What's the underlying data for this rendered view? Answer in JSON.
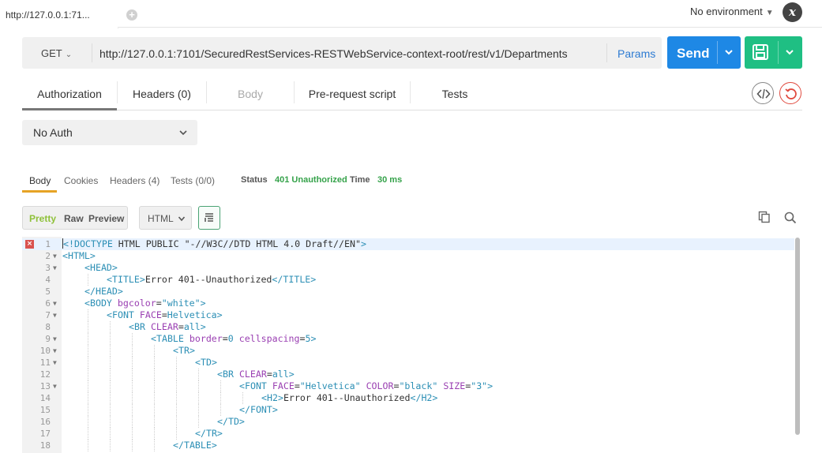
{
  "tab": {
    "label": "http://127.0.0.1:71...",
    "add_label": "+"
  },
  "environment": {
    "label": "No environment",
    "clear_label": "x"
  },
  "request": {
    "method": "GET",
    "url": "http://127.0.0.1:7101/SecuredRestServices-RESTWebService-context-root/rest/v1/Departments",
    "params_label": "Params",
    "send_label": "Send"
  },
  "request_tabs": [
    {
      "label": "Authorization",
      "active": true
    },
    {
      "label": "Headers (0)"
    },
    {
      "label": "Body",
      "disabled": true
    },
    {
      "label": "Pre-request script"
    },
    {
      "label": "Tests"
    }
  ],
  "auth": {
    "selected": "No Auth"
  },
  "response_tabs": [
    {
      "label": "Body",
      "active": true
    },
    {
      "label": "Cookies"
    },
    {
      "label": "Headers (4)"
    },
    {
      "label": "Tests (0/0)"
    }
  ],
  "status": {
    "status_label": "Status",
    "status_value": "401 Unauthorized",
    "time_label": "Time",
    "time_value": "30 ms"
  },
  "view": {
    "modes": [
      "Pretty",
      "Raw",
      "Preview"
    ],
    "active_mode": "Pretty",
    "language": "HTML"
  },
  "colors": {
    "send": "#1e88e5",
    "save": "#1fbf83",
    "status_ok": "#35a24a",
    "accent": "#e6a325"
  },
  "icons": [
    "chevron-down-icon",
    "save-icon",
    "code-icon",
    "reset-icon",
    "wrap-icon",
    "copy-icon",
    "search-icon",
    "error-icon"
  ],
  "code_lines": [
    {
      "n": "1",
      "text": "<!DOCTYPE HTML PUBLIC \"-//W3C//DTD HTML 4.0 Draft//EN\">"
    },
    {
      "n": "2",
      "text": "<HTML>"
    },
    {
      "n": "3",
      "text": "<HEAD>"
    },
    {
      "n": "4",
      "text": "<TITLE>Error 401--Unauthorized</TITLE>"
    },
    {
      "n": "5",
      "text": "</HEAD>"
    },
    {
      "n": "6",
      "text": "<BODY bgcolor=\"white\">"
    },
    {
      "n": "7",
      "text": "<FONT FACE=Helvetica>"
    },
    {
      "n": "8",
      "text": "<BR CLEAR=all>"
    },
    {
      "n": "9",
      "text": "<TABLE border=0 cellspacing=5>"
    },
    {
      "n": "10",
      "text": "<TR>"
    },
    {
      "n": "11",
      "text": "<TD>"
    },
    {
      "n": "12",
      "text": "<BR CLEAR=all>"
    },
    {
      "n": "13",
      "text": "<FONT FACE=\"Helvetica\" COLOR=\"black\" SIZE=\"3\">"
    },
    {
      "n": "14",
      "text": "<H2>Error 401--Unauthorized</H2>"
    },
    {
      "n": "15",
      "text": "</FONT>"
    },
    {
      "n": "16",
      "text": "</TD>"
    },
    {
      "n": "17",
      "text": "</TR>"
    },
    {
      "n": "18",
      "text": "</TABLE>"
    }
  ]
}
